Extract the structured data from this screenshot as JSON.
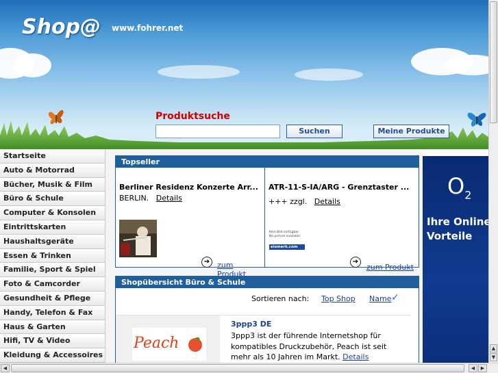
{
  "header": {
    "logo": "Shop@",
    "site_url": "www.fohrer.net"
  },
  "search": {
    "title": "Produktsuche",
    "placeholder": "",
    "search_button": "Suchen",
    "my_products_button": "Meine Produkte"
  },
  "sidebar": {
    "items": [
      {
        "label": "Startseite"
      },
      {
        "label": "Auto & Motorrad"
      },
      {
        "label": "Bücher, Musik & Film"
      },
      {
        "label": "Büro & Schule"
      },
      {
        "label": "Computer & Konsolen"
      },
      {
        "label": "Eintrittskarten"
      },
      {
        "label": "Haushaltsgeräte"
      },
      {
        "label": "Essen & Trinken"
      },
      {
        "label": "Familie, Sport & Spiel"
      },
      {
        "label": "Foto & Camcorder"
      },
      {
        "label": "Gesundheit & Pflege"
      },
      {
        "label": "Handy, Telefon & Fax"
      },
      {
        "label": "Haus & Garten"
      },
      {
        "label": "Hifi, TV & Video"
      },
      {
        "label": "Kleidung & Accessoires"
      }
    ]
  },
  "topseller": {
    "heading": "Topseller",
    "products": [
      {
        "title": "Berliner Residenz Konzerte Arr...",
        "sub": "BERLIN.",
        "details": "Details",
        "cta": "zum Produkt"
      },
      {
        "title": "ATR-11-S-IA/ARG - Grenztaster ...",
        "sub": "+++ zzgl.",
        "details": "Details",
        "cta": "zum Produkt",
        "img_caption_1": "Kein Bild verfügbar",
        "img_caption_2": "No picture available",
        "img_brand": "eismerk.com"
      }
    ]
  },
  "overview": {
    "heading": "Shopübersicht Büro & Schule",
    "sort_label": "Sortieren nach:",
    "sort_top": "Top Shop",
    "sort_name": "Name",
    "shop": {
      "logo_text": "Peach",
      "name": "3ppp3 DE",
      "description": "3ppp3 ist der führende Internetshop für kompatibles Druckzubehör, Peach ist seit mehr als 10 Jahren im Markt.",
      "details": "Details"
    }
  },
  "ad": {
    "logo": "O",
    "logo_sub": "2",
    "line1": "Ihre Online",
    "line2": "Vorteile"
  },
  "colors": {
    "header_blue": "#1f6fb8",
    "box_blue": "#1f5f9c",
    "search_title_red": "#d10000",
    "ad_blue": "#0a2b72"
  }
}
